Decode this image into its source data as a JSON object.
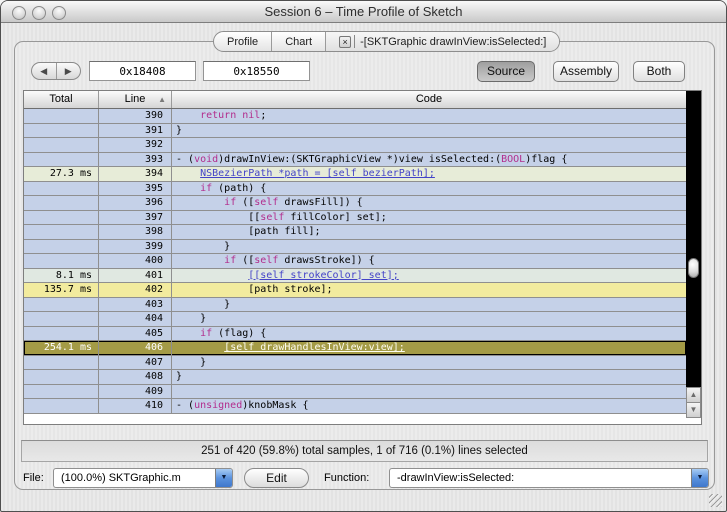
{
  "window": {
    "title": "Session 6 – Time Profile of Sketch"
  },
  "icons": {
    "back": "◀",
    "forward": "▶",
    "sort_asc": "▲",
    "dropdown": "▼",
    "tab_close": "×",
    "scroll_up": "▲",
    "scroll_down": "▼"
  },
  "tabs": [
    {
      "label": "Profile",
      "closable": false,
      "active": false
    },
    {
      "label": "Chart",
      "closable": false,
      "active": false
    },
    {
      "label": "-[SKTGraphic drawInView:isSelected:]",
      "closable": true,
      "active": true
    }
  ],
  "toolbar": {
    "address_from": "0x18408",
    "address_to": "0x18550",
    "view_buttons": [
      {
        "label": "Source",
        "active": true
      },
      {
        "label": "Assembly",
        "active": false
      },
      {
        "label": "Both",
        "active": false
      }
    ]
  },
  "table": {
    "columns": [
      "Total",
      "Line",
      "Code"
    ],
    "sort_column": "Line",
    "sort_direction": "ascending",
    "rows": [
      {
        "total": "",
        "line": "390",
        "bg": "default",
        "segments": [
          {
            "t": "    ",
            "s": "p"
          },
          {
            "t": "return nil",
            "s": "k"
          },
          {
            "t": ";",
            "s": "p"
          }
        ]
      },
      {
        "total": "",
        "line": "391",
        "bg": "default",
        "segments": [
          {
            "t": "}",
            "s": "p"
          }
        ]
      },
      {
        "total": "",
        "line": "392",
        "bg": "default",
        "segments": []
      },
      {
        "total": "",
        "line": "393",
        "bg": "default",
        "segments": [
          {
            "t": "- (",
            "s": "p"
          },
          {
            "t": "void",
            "s": "k"
          },
          {
            "t": ")drawInView:(SKTGraphicView *)view isSelected:(",
            "s": "p"
          },
          {
            "t": "BOOL",
            "s": "k"
          },
          {
            "t": ")flag {",
            "s": "p"
          }
        ]
      },
      {
        "total": "27.3 ms",
        "line": "394",
        "bg": "green",
        "segments": [
          {
            "t": "    ",
            "s": "p"
          },
          {
            "t": "NSBezierPath *path = [self bezierPath];",
            "s": "l"
          }
        ]
      },
      {
        "total": "",
        "line": "395",
        "bg": "default",
        "segments": [
          {
            "t": "    ",
            "s": "p"
          },
          {
            "t": "if",
            "s": "k"
          },
          {
            "t": " (path) {",
            "s": "p"
          }
        ]
      },
      {
        "total": "",
        "line": "396",
        "bg": "default",
        "segments": [
          {
            "t": "        ",
            "s": "p"
          },
          {
            "t": "if",
            "s": "k"
          },
          {
            "t": " ([",
            "s": "p"
          },
          {
            "t": "self",
            "s": "k"
          },
          {
            "t": " drawsFill]) {",
            "s": "p"
          }
        ]
      },
      {
        "total": "",
        "line": "397",
        "bg": "default",
        "segments": [
          {
            "t": "            [[",
            "s": "p"
          },
          {
            "t": "self",
            "s": "k"
          },
          {
            "t": " fillColor] set];",
            "s": "p"
          }
        ]
      },
      {
        "total": "",
        "line": "398",
        "bg": "default",
        "segments": [
          {
            "t": "            [path fill];",
            "s": "p"
          }
        ]
      },
      {
        "total": "",
        "line": "399",
        "bg": "default",
        "segments": [
          {
            "t": "        }",
            "s": "p"
          }
        ]
      },
      {
        "total": "",
        "line": "400",
        "bg": "default",
        "segments": [
          {
            "t": "        ",
            "s": "p"
          },
          {
            "t": "if",
            "s": "k"
          },
          {
            "t": " ([",
            "s": "p"
          },
          {
            "t": "self",
            "s": "k"
          },
          {
            "t": " drawsStroke]) {",
            "s": "p"
          }
        ]
      },
      {
        "total": "8.1 ms",
        "line": "401",
        "bg": "palegreen",
        "segments": [
          {
            "t": "            ",
            "s": "p"
          },
          {
            "t": "[[self strokeColor] set];",
            "s": "l"
          }
        ]
      },
      {
        "total": "135.7 ms",
        "line": "402",
        "bg": "yellow",
        "segments": [
          {
            "t": "            [path stroke];",
            "s": "p"
          }
        ]
      },
      {
        "total": "",
        "line": "403",
        "bg": "default",
        "segments": [
          {
            "t": "        }",
            "s": "p"
          }
        ]
      },
      {
        "total": "",
        "line": "404",
        "bg": "default",
        "segments": [
          {
            "t": "    }",
            "s": "p"
          }
        ]
      },
      {
        "total": "",
        "line": "405",
        "bg": "default",
        "segments": [
          {
            "t": "    ",
            "s": "p"
          },
          {
            "t": "if",
            "s": "k"
          },
          {
            "t": " (flag) {",
            "s": "p"
          }
        ]
      },
      {
        "total": "254.1 ms",
        "line": "406",
        "bg": "selected",
        "segments": [
          {
            "t": "        ",
            "s": "p"
          },
          {
            "t": "[self drawHandlesInView:view];",
            "s": "l"
          }
        ]
      },
      {
        "total": "",
        "line": "407",
        "bg": "default",
        "segments": [
          {
            "t": "    }",
            "s": "p"
          }
        ]
      },
      {
        "total": "",
        "line": "408",
        "bg": "default",
        "segments": [
          {
            "t": "}",
            "s": "p"
          }
        ]
      },
      {
        "total": "",
        "line": "409",
        "bg": "default",
        "segments": []
      },
      {
        "total": "",
        "line": "410",
        "bg": "default",
        "segments": [
          {
            "t": "- (",
            "s": "p"
          },
          {
            "t": "unsigned",
            "s": "k"
          },
          {
            "t": ")knobMask {",
            "s": "p"
          }
        ]
      }
    ]
  },
  "status": "251 of 420 (59.8%) total samples, 1 of 716 (0.1%) lines selected",
  "footer": {
    "file_label": "File:",
    "file_value": "(100.0%) SKTGraphic.m",
    "edit_label": "Edit",
    "function_label": "Function:",
    "function_value": "-drawInView:isSelected:"
  },
  "colors": {
    "row_default": "#c5d1e8",
    "row_hot_green": "#e7ecd8",
    "row_hot_palegreen": "#e0e8e1",
    "row_hot_yellow": "#f2eb9e",
    "row_selected": "#a49b46",
    "link_text": "#4343c8",
    "keyword_text": "#b22d8d"
  }
}
